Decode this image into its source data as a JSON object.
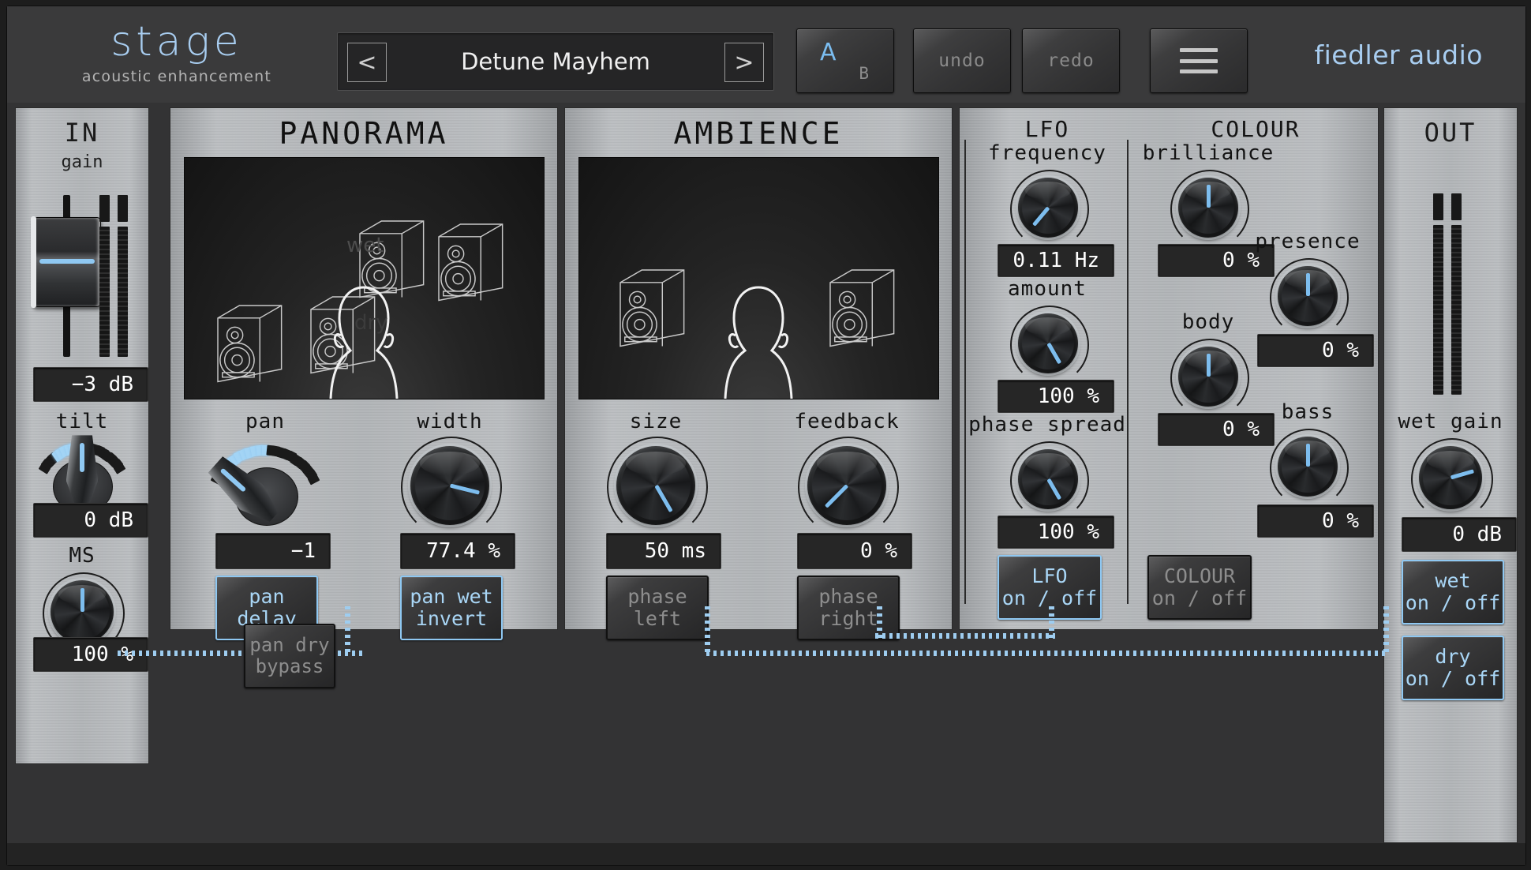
{
  "header": {
    "logo_title": "stage",
    "logo_subtitle": "acoustic enhancement",
    "preset_prev": "<",
    "preset_next": ">",
    "preset_name": "Detune Mayhem",
    "ab_a": "A",
    "ab_b": "B",
    "undo_label": "undo",
    "redo_label": "redo",
    "menu_icon": "hamburger-menu-icon",
    "brand": "fiedler audio"
  },
  "in_strip": {
    "title": "IN",
    "subtitle": "gain",
    "gain_value": "−3 dB",
    "tilt_label": "tilt",
    "tilt_value": "0 dB",
    "ms_label": "MS",
    "ms_value": "100 %"
  },
  "out_strip": {
    "title": "OUT",
    "wet_gain_label": "wet gain",
    "wet_gain_value": "0 dB",
    "wet_toggle": "wet\non / off",
    "dry_toggle": "dry\non / off"
  },
  "panorama": {
    "title": "PANORAMA",
    "scene_label_wet": "wet",
    "scene_label_dry": "dry",
    "pan_label": "pan",
    "pan_value": "−1",
    "width_label": "width",
    "width_value": "77.4 %",
    "pan_delay_toggle": "pan\ndelay",
    "pan_wet_invert_toggle": "pan wet\ninvert"
  },
  "ambience": {
    "title": "AMBIENCE",
    "size_label": "size",
    "size_value": "50 ms",
    "feedback_label": "feedback",
    "feedback_value": "0 %",
    "phase_left_toggle": "phase\nleft",
    "phase_right_toggle": "phase\nright"
  },
  "lfo": {
    "title": "LFO",
    "frequency_label": "frequency",
    "frequency_value": "0.11 Hz",
    "amount_label": "amount",
    "amount_value": "100 %",
    "phase_spread_label": "phase spread",
    "phase_spread_value": "100 %",
    "toggle": "LFO\non / off"
  },
  "colour": {
    "title": "COLOUR",
    "brilliance_label": "brilliance",
    "brilliance_value": "0 %",
    "presence_label": "presence",
    "presence_value": "0 %",
    "body_label": "body",
    "body_value": "0 %",
    "bass_label": "bass",
    "bass_value": "0 %",
    "toggle": "COLOUR\non / off"
  },
  "routing": {
    "pan_dry_bypass_toggle": "pan dry\nbypass"
  },
  "colors": {
    "accent_blue": "#8fc8f2",
    "panel_metal": "#b2b5b8",
    "chassis": "#333334",
    "display_bg": "#262626",
    "inactive_text": "#8d8d8d"
  }
}
